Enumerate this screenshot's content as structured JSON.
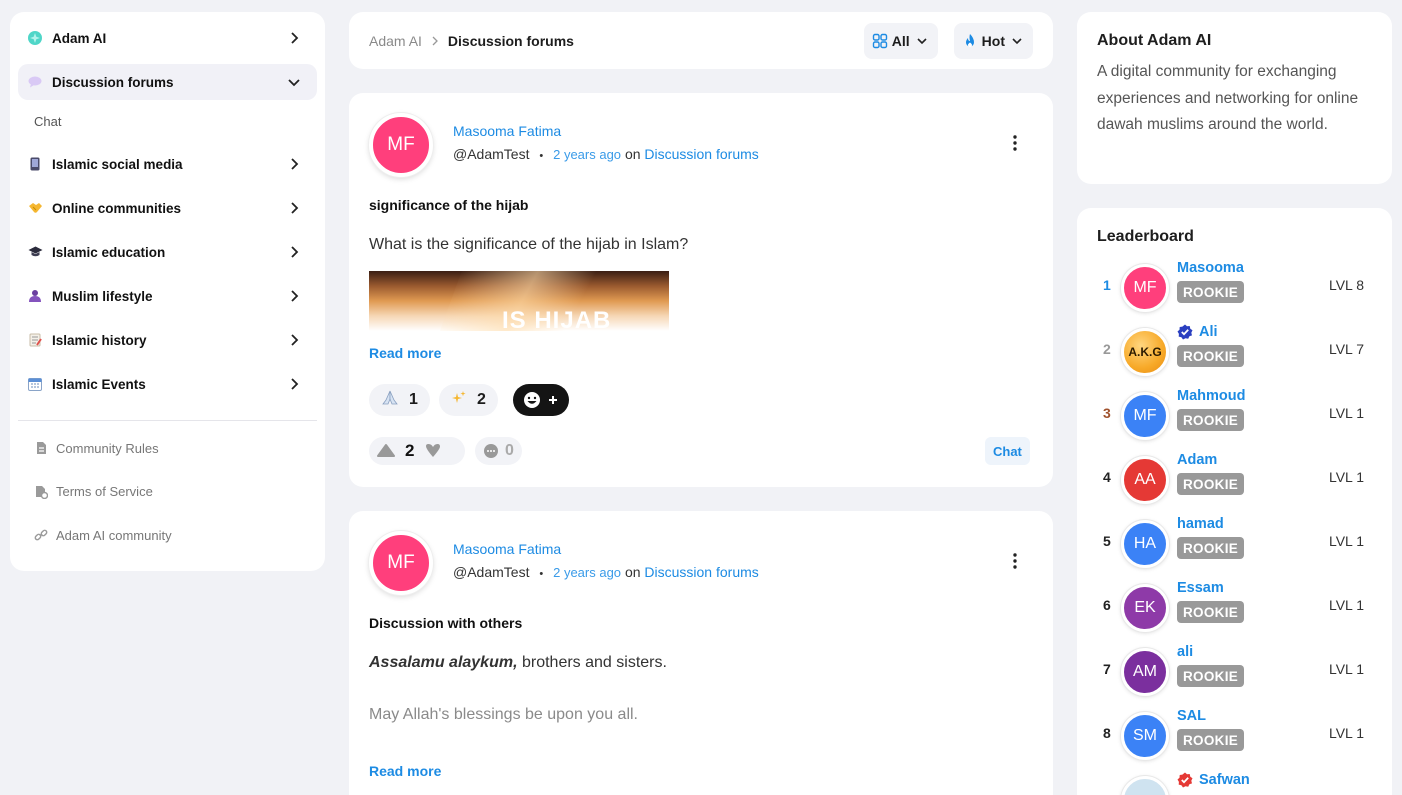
{
  "sidebar": {
    "items": [
      {
        "label": "Adam AI",
        "icon": "sparkle-icon",
        "expanded": false
      },
      {
        "label": "Discussion forums",
        "icon": "speech-bubble-icon",
        "expanded": true
      },
      {
        "label": "Islamic social media",
        "icon": "phone-icon",
        "expanded": false
      },
      {
        "label": "Online communities",
        "icon": "handshake-icon",
        "expanded": false
      },
      {
        "label": "Islamic education",
        "icon": "graduation-cap-icon",
        "expanded": false
      },
      {
        "label": "Muslim lifestyle",
        "icon": "people-icon",
        "expanded": false
      },
      {
        "label": "Islamic history",
        "icon": "scroll-icon",
        "expanded": false
      },
      {
        "label": "Islamic Events",
        "icon": "calendar-icon",
        "expanded": false
      }
    ],
    "sub_items": [
      "Chat"
    ],
    "footer_links": [
      {
        "label": "Community Rules",
        "icon": "document-icon"
      },
      {
        "label": "Terms of Service",
        "icon": "document-settings-icon"
      },
      {
        "label": "Adam AI community",
        "icon": "link-icon"
      }
    ]
  },
  "topbar": {
    "breadcrumb_root": "Adam AI",
    "breadcrumb_current": "Discussion forums",
    "filter_label": "All",
    "sort_label": "Hot"
  },
  "posts": [
    {
      "author_initials": "MF",
      "author": "Masooma Fatima",
      "handle": "@AdamTest",
      "separator": "•",
      "time_ago": "2 years ago",
      "on": "on",
      "category": "Discussion forums",
      "title": "significance of the hijab",
      "body": "What is the significance of the hijab in Islam?",
      "image_text": "IS HIJAB",
      "read_more": "Read more",
      "reactions": [
        {
          "icon": "praying-hands-icon",
          "count": "1"
        },
        {
          "icon": "sparkles-icon",
          "count": "2"
        }
      ],
      "upvotes": "2",
      "comments": "0",
      "chat_label": "Chat"
    },
    {
      "author_initials": "MF",
      "author": "Masooma Fatima",
      "handle": "@AdamTest",
      "separator": "•",
      "time_ago": "2 years ago",
      "on": "on",
      "category": "Discussion forums",
      "title": "Discussion with others",
      "body_em": "Assalamu alaykum,",
      "body_rest": " brothers and sisters.",
      "body_2": "May Allah's blessings be upon you all.",
      "read_more": "Read more"
    }
  ],
  "about": {
    "title": "About Adam AI",
    "text": "A digital community for exchanging experiences and networking for online dawah muslims around the world."
  },
  "leaderboard": {
    "title": "Leaderboard",
    "rows": [
      {
        "rank": "1",
        "initials": "MF",
        "name": "Masooma",
        "badge": "ROOKIE",
        "level": "LVL 8",
        "color": "#ff3f7c",
        "rank_color": "#1d8be3",
        "verified": ""
      },
      {
        "rank": "2",
        "initials": "A.K.G",
        "name": "Ali",
        "badge": "ROOKIE",
        "level": "LVL 7",
        "color": "#f7a928",
        "rank_color": "#999999",
        "verified": "blue"
      },
      {
        "rank": "3",
        "initials": "MF",
        "name": "Mahmoud",
        "badge": "ROOKIE",
        "level": "LVL 1",
        "color": "#3b82f6",
        "rank_color": "#a0522d",
        "verified": ""
      },
      {
        "rank": "4",
        "initials": "AA",
        "name": "Adam",
        "badge": "ROOKIE",
        "level": "LVL 1",
        "color": "#e53935",
        "rank_color": "#222222",
        "verified": ""
      },
      {
        "rank": "5",
        "initials": "HA",
        "name": "hamad",
        "badge": "ROOKIE",
        "level": "LVL 1",
        "color": "#3b82f6",
        "rank_color": "#222222",
        "verified": ""
      },
      {
        "rank": "6",
        "initials": "EK",
        "name": "Essam",
        "badge": "ROOKIE",
        "level": "LVL 1",
        "color": "#8e3aa8",
        "rank_color": "#222222",
        "verified": ""
      },
      {
        "rank": "7",
        "initials": "AM",
        "name": "ali",
        "badge": "ROOKIE",
        "level": "LVL 1",
        "color": "#7b2f9e",
        "rank_color": "#222222",
        "verified": ""
      },
      {
        "rank": "8",
        "initials": "SM",
        "name": "SAL",
        "badge": "ROOKIE",
        "level": "LVL 1",
        "color": "#3b82f6",
        "rank_color": "#222222",
        "verified": ""
      },
      {
        "rank": "",
        "initials": "",
        "name": "Safwan",
        "badge": "",
        "level": "",
        "color": "#cfe3f0",
        "rank_color": "#222222",
        "verified": "red"
      }
    ]
  }
}
